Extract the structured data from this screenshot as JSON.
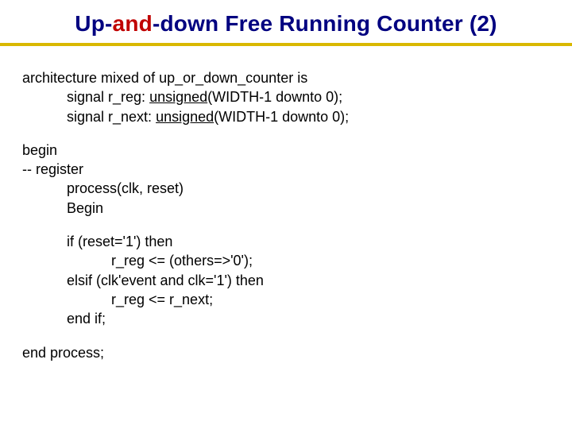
{
  "title": {
    "prefix": "Up-",
    "highlight": "and",
    "suffix": "-down Free Running Counter (2)"
  },
  "code": {
    "l1_a": "architecture mixed of up_or_down_counter is",
    "l2_a": "signal r_reg: ",
    "l2_u": "unsigned",
    "l2_b": "(WIDTH-1 downto 0);",
    "l3_a": "signal r_next: ",
    "l3_u": "unsigned",
    "l3_b": "(WIDTH-1 downto 0);",
    "l4": "begin",
    "l5": "-- register",
    "l6": "process(clk, reset)",
    "l7": "Begin",
    "l8": "if (reset='1') then",
    "l9": "r_reg <= (others=>'0');",
    "l10": "elsif (clk'event and clk='1') then",
    "l11": "r_reg <= r_next;",
    "l12": "end if;",
    "l13": "end process;"
  }
}
